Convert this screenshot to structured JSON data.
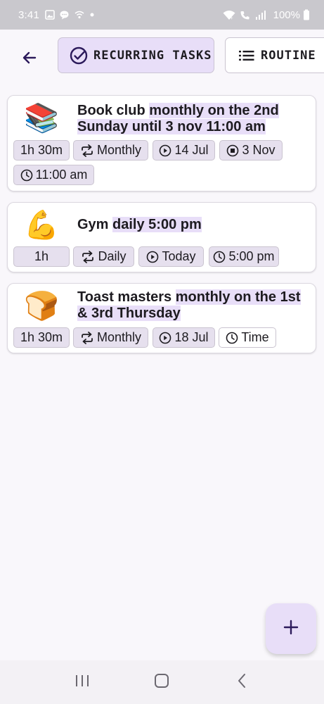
{
  "status_bar": {
    "time": "3:41",
    "battery": "100%",
    "icons": [
      "gallery-icon",
      "chat-icon",
      "hotspot-icon",
      "dot-icon",
      "wifi-icon",
      "call-icon",
      "signal-icon",
      "battery-icon"
    ]
  },
  "top_bar": {
    "back_icon": "arrow-left-icon",
    "tabs": [
      {
        "label": "RECURRING TASKS",
        "icon": "check-circle-icon",
        "active": true
      },
      {
        "label": "ROUTINE L",
        "icon": "list-icon",
        "active": false
      }
    ]
  },
  "tasks": [
    {
      "emoji": "📚",
      "name": "Book club",
      "schedule": "monthly on the 2nd Sunday until 3 nov 11:00 am",
      "chips": {
        "duration": "1h 30m",
        "repeat": "Monthly",
        "start": "14 Jul",
        "end": "3 Nov",
        "time": "11:00 am"
      }
    },
    {
      "emoji": "💪",
      "name": "Gym",
      "schedule": "daily 5:00 pm",
      "chips": {
        "duration": "1h",
        "repeat": "Daily",
        "start": "Today",
        "time": "5:00 pm"
      }
    },
    {
      "emoji": "🍞",
      "name": "Toast masters",
      "schedule": "monthly on the 1st & 3rd Thursday",
      "chips": {
        "duration": "1h 30m",
        "repeat": "Monthly",
        "start": "18 Jul",
        "time": "Time"
      }
    }
  ],
  "fab": {
    "icon": "plus-icon",
    "label": "+"
  },
  "nav_bar": {
    "icons": [
      "recents-icon",
      "home-icon",
      "back-icon"
    ]
  },
  "colors": {
    "accent_container": "#e8def8",
    "chip_bg": "#e6e0ee",
    "primary": "#2c1a5b",
    "status_bar": "#c9c8cd"
  }
}
